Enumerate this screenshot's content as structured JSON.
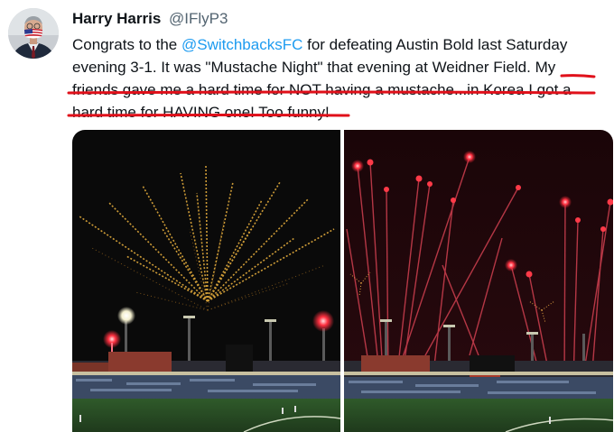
{
  "tweet": {
    "display_name": "Harry Harris",
    "handle": "@IFlyP3",
    "text_line1_pre": "Congrats to the ",
    "mention": "@SwitchbacksFC",
    "text_line1_post": " for defeating Austin Bold last Saturday",
    "text_line2": "evening 3-1.  It was \"Mustache Night\" that evening at Weidner Field.  My",
    "text_line3": "friends gave me a hard time for NOT having a mustache...in Korea I got a",
    "text_line4": "hard time for HAVING one!  Too funny!"
  },
  "media": {
    "photo_1": "fireworks-stadium-photo",
    "photo_2": "fireworks-stadium-photo"
  },
  "colors": {
    "text": "#0f1419",
    "muted": "#536471",
    "link": "#1d9bf0",
    "underline": "#e0101a"
  },
  "icons": {
    "flag_mask": "us-flag-mask-icon"
  }
}
